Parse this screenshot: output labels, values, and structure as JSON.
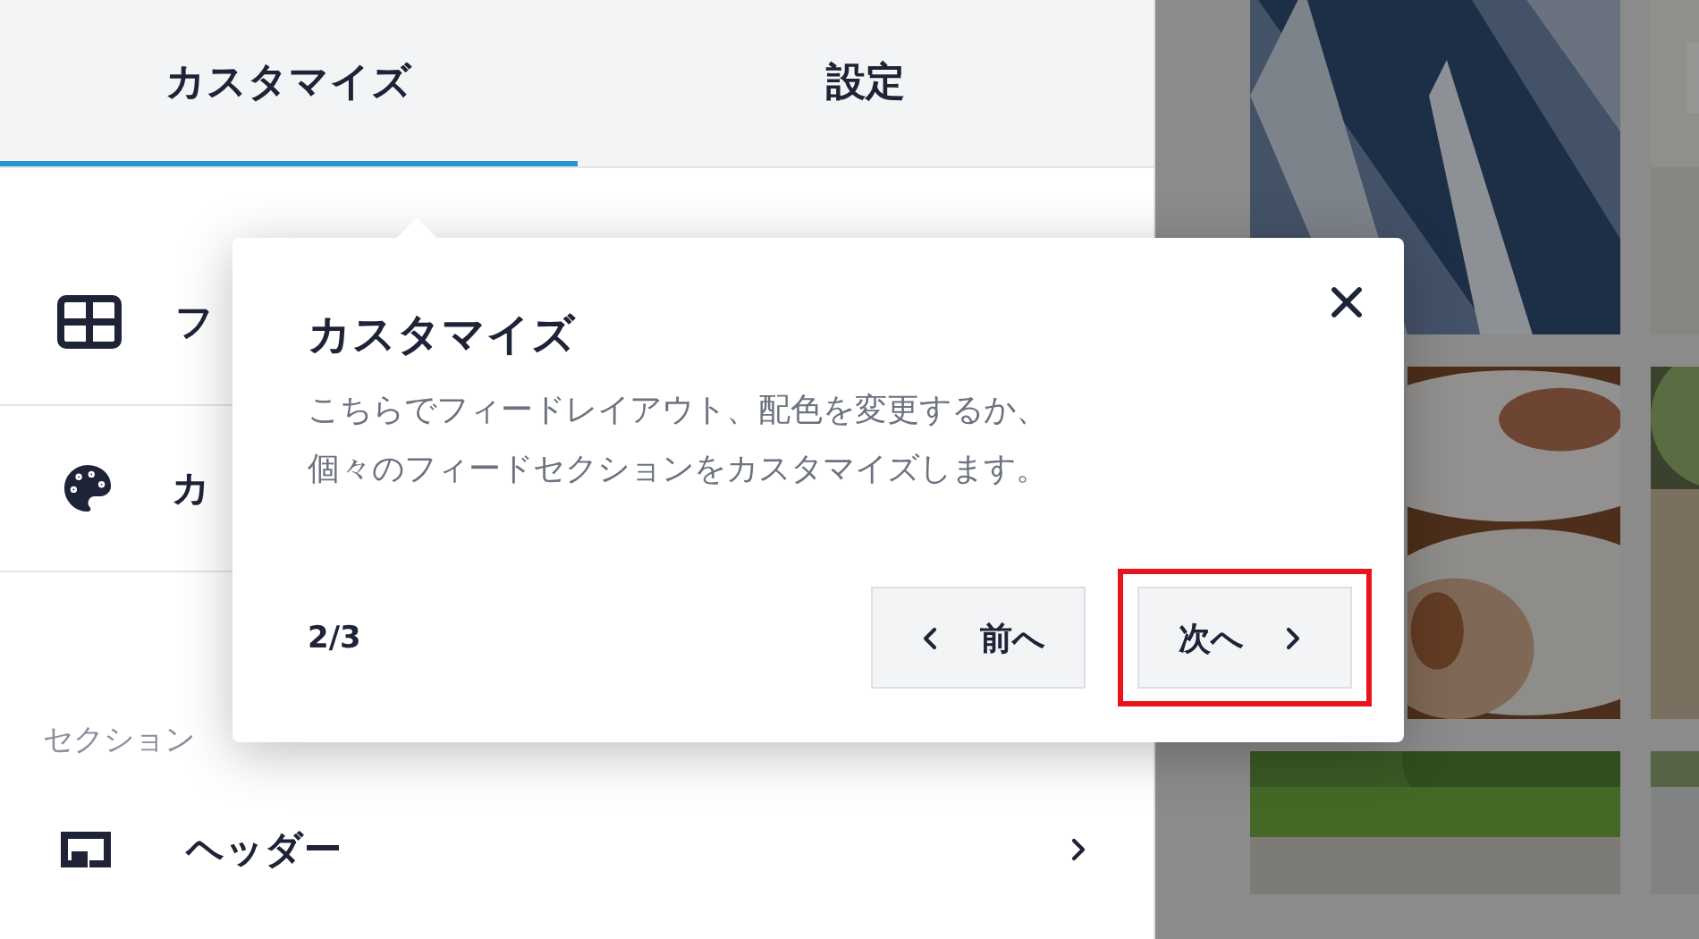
{
  "tabs": [
    {
      "label": "カスタマイズ",
      "selected": true
    },
    {
      "label": "設定",
      "selected": false
    }
  ],
  "menu_items": [
    {
      "kind": "layout",
      "label": "フ"
    },
    {
      "kind": "colors",
      "label": "カ"
    }
  ],
  "section_label": "セクション",
  "sections": [
    {
      "kind": "header",
      "label": "ヘッダー"
    }
  ],
  "tour_popover": {
    "title": "カスタマイズ",
    "body_lines": [
      "こちらでフィードレイアウト、配色を変更するか、",
      "個々のフィードセクションをカスタマイズします。"
    ],
    "step": "2/3",
    "prev_button": "前へ",
    "next_button": "次へ",
    "next_highlighted": true
  }
}
